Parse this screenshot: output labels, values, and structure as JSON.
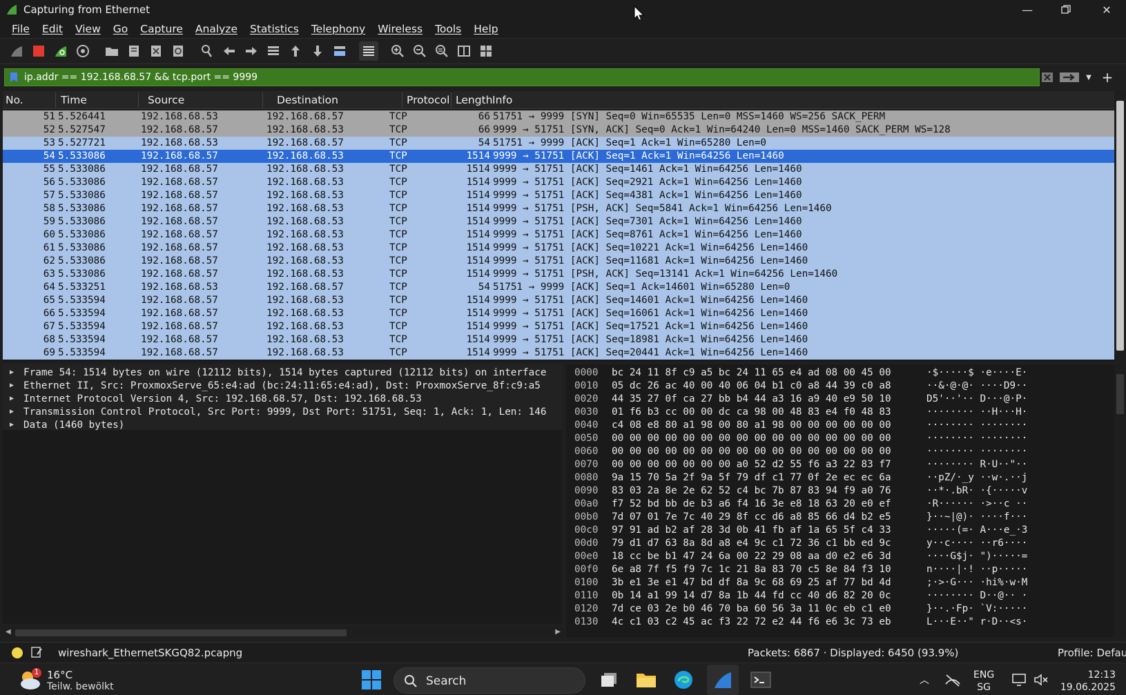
{
  "window": {
    "title": "Capturing from Ethernet",
    "controls": [
      "minimize",
      "restore",
      "close"
    ]
  },
  "menu": [
    "File",
    "Edit",
    "View",
    "Go",
    "Capture",
    "Analyze",
    "Statistics",
    "Telephony",
    "Wireless",
    "Tools",
    "Help"
  ],
  "filter": {
    "value": "ip.addr == 192.168.68.57 && tcp.port == 9999",
    "valid_color": "#3c7a1f"
  },
  "columns": [
    "No.",
    "Time",
    "Source",
    "Destination",
    "Protocol",
    "Length",
    "Info"
  ],
  "packets": [
    {
      "no": "51",
      "time": "5.526441",
      "src": "192.168.68.53",
      "dst": "192.168.68.57",
      "proto": "TCP",
      "len": "66",
      "info": "51751 → 9999 [SYN] Seq=0 Win=65535 Len=0 MSS=1460 WS=256 SACK_PERM",
      "kind": "syn"
    },
    {
      "no": "52",
      "time": "5.527547",
      "src": "192.168.68.57",
      "dst": "192.168.68.53",
      "proto": "TCP",
      "len": "66",
      "info": "9999 → 51751 [SYN, ACK] Seq=0 Ack=1 Win=64240 Len=0 MSS=1460 SACK_PERM WS=128",
      "kind": "syn"
    },
    {
      "no": "53",
      "time": "5.527721",
      "src": "192.168.68.53",
      "dst": "192.168.68.57",
      "proto": "TCP",
      "len": "54",
      "info": "51751 → 9999 [ACK] Seq=1 Ack=1 Win=65280 Len=0",
      "kind": "tcp"
    },
    {
      "no": "54",
      "time": "5.533086",
      "src": "192.168.68.57",
      "dst": "192.168.68.53",
      "proto": "TCP",
      "len": "1514",
      "info": "9999 → 51751 [ACK] Seq=1 Ack=1 Win=64256 Len=1460",
      "kind": "sel"
    },
    {
      "no": "55",
      "time": "5.533086",
      "src": "192.168.68.57",
      "dst": "192.168.68.53",
      "proto": "TCP",
      "len": "1514",
      "info": "9999 → 51751 [ACK] Seq=1461 Ack=1 Win=64256 Len=1460",
      "kind": "tcp"
    },
    {
      "no": "56",
      "time": "5.533086",
      "src": "192.168.68.57",
      "dst": "192.168.68.53",
      "proto": "TCP",
      "len": "1514",
      "info": "9999 → 51751 [ACK] Seq=2921 Ack=1 Win=64256 Len=1460",
      "kind": "tcp"
    },
    {
      "no": "57",
      "time": "5.533086",
      "src": "192.168.68.57",
      "dst": "192.168.68.53",
      "proto": "TCP",
      "len": "1514",
      "info": "9999 → 51751 [ACK] Seq=4381 Ack=1 Win=64256 Len=1460",
      "kind": "tcp"
    },
    {
      "no": "58",
      "time": "5.533086",
      "src": "192.168.68.57",
      "dst": "192.168.68.53",
      "proto": "TCP",
      "len": "1514",
      "info": "9999 → 51751 [PSH, ACK] Seq=5841 Ack=1 Win=64256 Len=1460",
      "kind": "tcp"
    },
    {
      "no": "59",
      "time": "5.533086",
      "src": "192.168.68.57",
      "dst": "192.168.68.53",
      "proto": "TCP",
      "len": "1514",
      "info": "9999 → 51751 [ACK] Seq=7301 Ack=1 Win=64256 Len=1460",
      "kind": "tcp"
    },
    {
      "no": "60",
      "time": "5.533086",
      "src": "192.168.68.57",
      "dst": "192.168.68.53",
      "proto": "TCP",
      "len": "1514",
      "info": "9999 → 51751 [ACK] Seq=8761 Ack=1 Win=64256 Len=1460",
      "kind": "tcp"
    },
    {
      "no": "61",
      "time": "5.533086",
      "src": "192.168.68.57",
      "dst": "192.168.68.53",
      "proto": "TCP",
      "len": "1514",
      "info": "9999 → 51751 [ACK] Seq=10221 Ack=1 Win=64256 Len=1460",
      "kind": "tcp"
    },
    {
      "no": "62",
      "time": "5.533086",
      "src": "192.168.68.57",
      "dst": "192.168.68.53",
      "proto": "TCP",
      "len": "1514",
      "info": "9999 → 51751 [ACK] Seq=11681 Ack=1 Win=64256 Len=1460",
      "kind": "tcp"
    },
    {
      "no": "63",
      "time": "5.533086",
      "src": "192.168.68.57",
      "dst": "192.168.68.53",
      "proto": "TCP",
      "len": "1514",
      "info": "9999 → 51751 [PSH, ACK] Seq=13141 Ack=1 Win=64256 Len=1460",
      "kind": "tcp"
    },
    {
      "no": "64",
      "time": "5.533251",
      "src": "192.168.68.53",
      "dst": "192.168.68.57",
      "proto": "TCP",
      "len": "54",
      "info": "51751 → 9999 [ACK] Seq=1 Ack=14601 Win=65280 Len=0",
      "kind": "tcp"
    },
    {
      "no": "65",
      "time": "5.533594",
      "src": "192.168.68.57",
      "dst": "192.168.68.53",
      "proto": "TCP",
      "len": "1514",
      "info": "9999 → 51751 [ACK] Seq=14601 Ack=1 Win=64256 Len=1460",
      "kind": "tcp"
    },
    {
      "no": "66",
      "time": "5.533594",
      "src": "192.168.68.57",
      "dst": "192.168.68.53",
      "proto": "TCP",
      "len": "1514",
      "info": "9999 → 51751 [ACK] Seq=16061 Ack=1 Win=64256 Len=1460",
      "kind": "tcp"
    },
    {
      "no": "67",
      "time": "5.533594",
      "src": "192.168.68.57",
      "dst": "192.168.68.53",
      "proto": "TCP",
      "len": "1514",
      "info": "9999 → 51751 [ACK] Seq=17521 Ack=1 Win=64256 Len=1460",
      "kind": "tcp"
    },
    {
      "no": "68",
      "time": "5.533594",
      "src": "192.168.68.57",
      "dst": "192.168.68.53",
      "proto": "TCP",
      "len": "1514",
      "info": "9999 → 51751 [ACK] Seq=18981 Ack=1 Win=64256 Len=1460",
      "kind": "tcp"
    },
    {
      "no": "69",
      "time": "5.533594",
      "src": "192.168.68.57",
      "dst": "192.168.68.53",
      "proto": "TCP",
      "len": "1514",
      "info": "9999 → 51751 [ACK] Seq=20441 Ack=1 Win=64256 Len=1460",
      "kind": "tcp"
    }
  ],
  "details": [
    "Frame 54: 1514 bytes on wire (12112 bits), 1514 bytes captured (12112 bits) on interface",
    "Ethernet II, Src: ProxmoxServe_65:e4:ad (bc:24:11:65:e4:ad), Dst: ProxmoxServe_8f:c9:a5",
    "Internet Protocol Version 4, Src: 192.168.68.57, Dst: 192.168.68.53",
    "Transmission Control Protocol, Src Port: 9999, Dst Port: 51751, Seq: 1, Ack: 1, Len: 146",
    "Data (1460 bytes)"
  ],
  "bytes": [
    {
      "off": "0000",
      "hex": "bc 24 11 8f c9 a5 bc 24  11 65 e4 ad 08 00 45 00",
      "ascii": "·$·····$ ·e····E·"
    },
    {
      "off": "0010",
      "hex": "05 dc 26 ac 40 00 40 06  04 b1 c0 a8 44 39 c0 a8",
      "ascii": "··&·@·@· ····D9··"
    },
    {
      "off": "0020",
      "hex": "44 35 27 0f ca 27 bb b4  44 a3 16 a9 40 e9 50 10",
      "ascii": "D5'··'·· D···@·P·"
    },
    {
      "off": "0030",
      "hex": "01 f6 b3 cc 00 00 dc ca  98 00 48 83 e4 f0 48 83",
      "ascii": "········ ··H···H·"
    },
    {
      "off": "0040",
      "hex": "c4 08 e8 80 a1 98 00 80  a1 98 00 00 00 00 00 00",
      "ascii": "········ ········"
    },
    {
      "off": "0050",
      "hex": "00 00 00 00 00 00 00 00  00 00 00 00 00 00 00 00",
      "ascii": "········ ········"
    },
    {
      "off": "0060",
      "hex": "00 00 00 00 00 00 00 00  00 00 00 00 00 00 00 00",
      "ascii": "········ ········"
    },
    {
      "off": "0070",
      "hex": "00 00 00 00 00 00 00 a0  52 d2 55 f6 a3 22 83 f7",
      "ascii": "········ R·U··\"··"
    },
    {
      "off": "0080",
      "hex": "9a 15 70 5a 2f 9a 5f 79  df c1 77 0f 2e ec ec 6a",
      "ascii": "··pZ/·_y ··w·.··j"
    },
    {
      "off": "0090",
      "hex": "83 03 2a 8e 2e 62 52 c4  bc 7b 87 83 94 f9 a0 76",
      "ascii": "··*·.bR· ·{·····v"
    },
    {
      "off": "00a0",
      "hex": "f7 52 bd bb de b3 a6 f4  16 3e e8 18 63 20 e0 ef",
      "ascii": "·R······ ·>··c ··"
    },
    {
      "off": "00b0",
      "hex": "7d 07 01 7e 7c 40 29 8f  cc d6 a8 85 66 d4 b2 e5",
      "ascii": "}··~|@)· ····f···"
    },
    {
      "off": "00c0",
      "hex": "97 91 ad b2 af 28 3d 0b  41 fb af 1a 65 5f c4 33",
      "ascii": "·····(=· A···e_·3"
    },
    {
      "off": "00d0",
      "hex": "79 d1 d7 63 8a 8d a8 e4  9c c1 72 36 c1 bb ed 9c",
      "ascii": "y··c···· ··r6····"
    },
    {
      "off": "00e0",
      "hex": "18 cc be b1 47 24 6a 00  22 29 08 aa d0 e2 e6 3d",
      "ascii": "····G$j· \")·····="
    },
    {
      "off": "00f0",
      "hex": "6e a8 7f f5 f9 7c 1c 21  8a 83 70 c5 8e 84 f3 10",
      "ascii": "n····|·! ··p·····"
    },
    {
      "off": "0100",
      "hex": "3b e1 3e e1 47 bd df 8a  9c 68 69 25 af 77 bd 4d",
      "ascii": ";·>·G··· ·hi%·w·M"
    },
    {
      "off": "0110",
      "hex": "0b 14 a1 99 14 d7 8a 1b  44 fd cc 40 d6 82 20 0c",
      "ascii": "········ D··@·· ·"
    },
    {
      "off": "0120",
      "hex": "7d ce 03 2e b0 46 70 ba  60 56 3a 11 0c eb c1 e0",
      "ascii": "}··.·Fp· `V:·····"
    },
    {
      "off": "0130",
      "hex": "4c c1 03 c2 45 ac f3 22  72 e2 44 f6 e6 3c 73 eb",
      "ascii": "L···E··\" r·D··<s·"
    }
  ],
  "status": {
    "file": "wireshark_EthernetSKGQ82.pcapng",
    "counts": "Packets: 6867 · Displayed: 6450 (93.9%)",
    "profile": "Profile: Default"
  },
  "taskbar": {
    "temperature": "16°C",
    "weather": "Teilw. bewölkt",
    "weather_badge": "1",
    "search": "Search",
    "lang_top": "ENG",
    "lang_bottom": "SG",
    "time": "12:13",
    "date": "19.06.2025"
  },
  "colors": {
    "row_tcp": "#a9c4e8",
    "row_syn": "#a6a6a6",
    "row_selected": "#2c6ad6"
  }
}
